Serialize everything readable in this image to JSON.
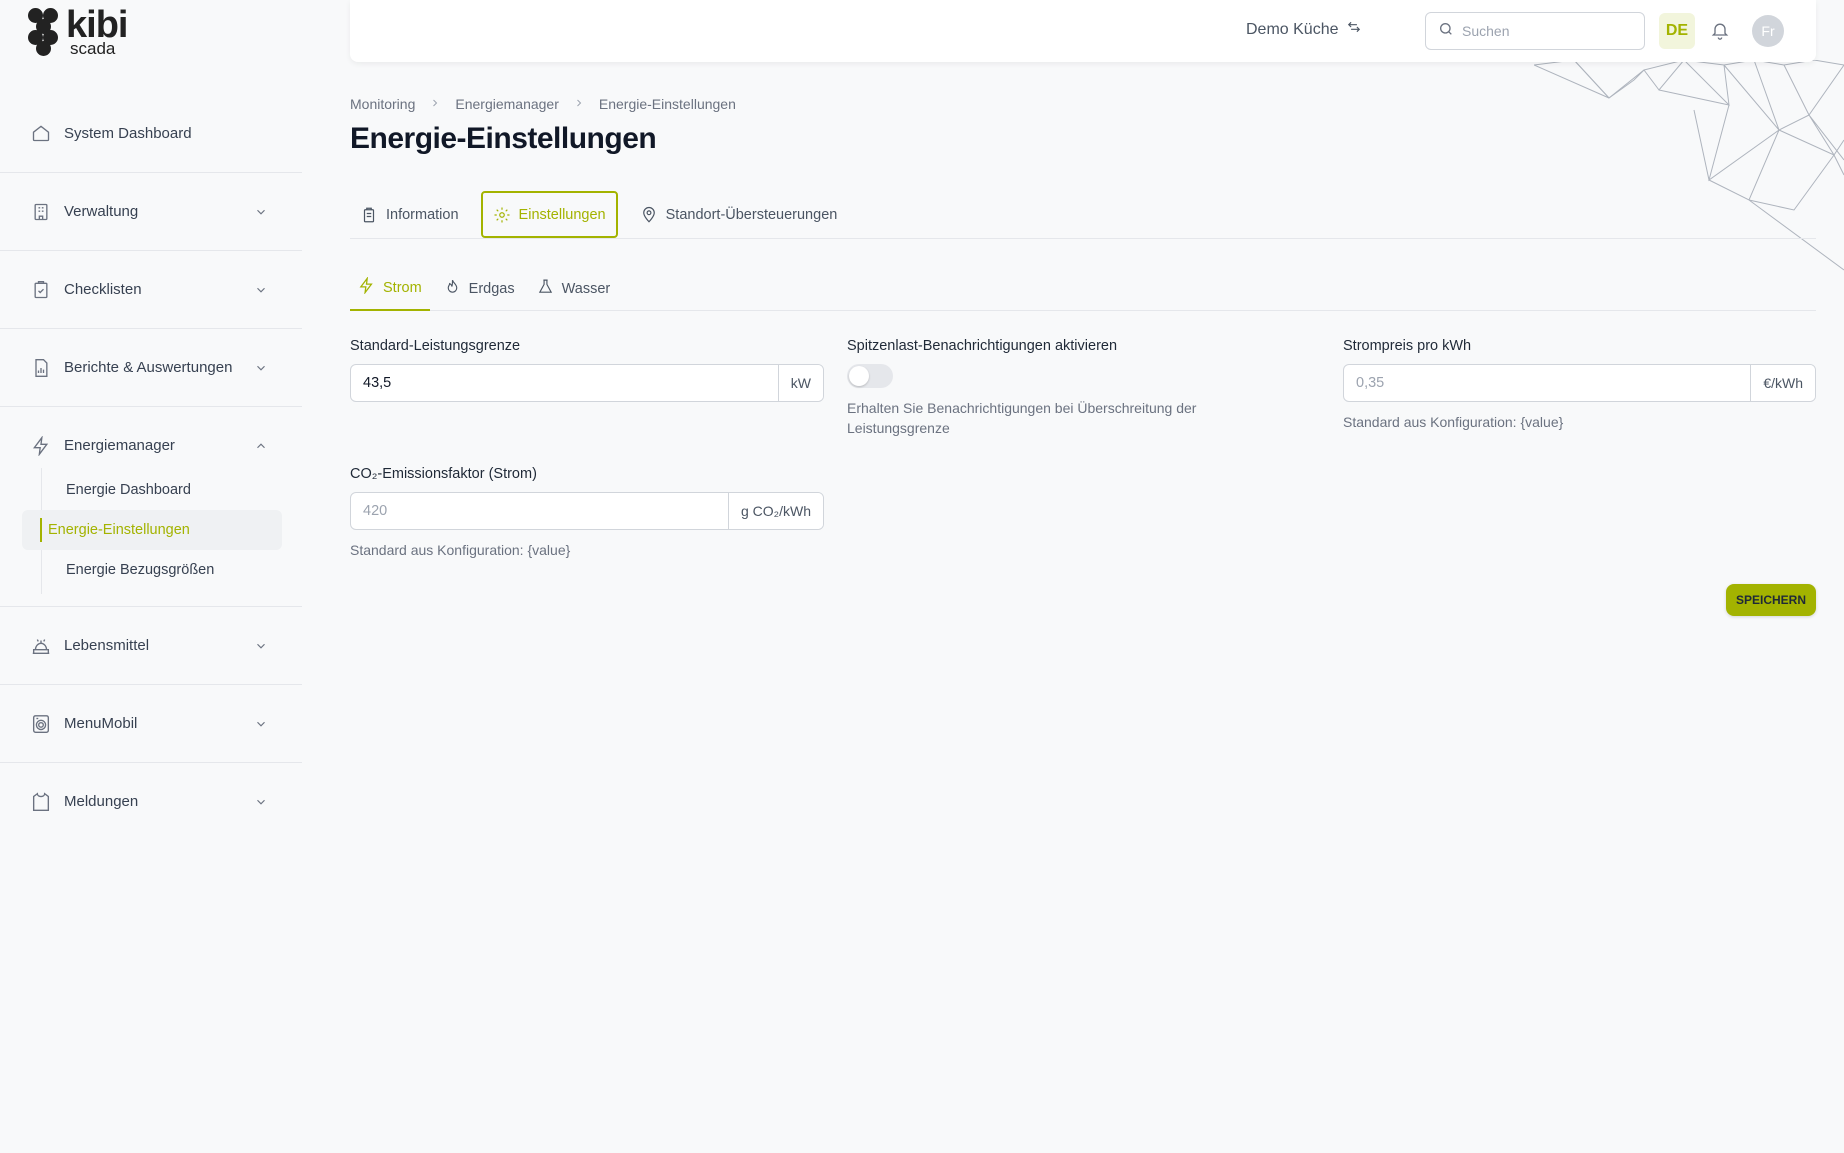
{
  "app": {
    "logo_name": "kibi",
    "logo_sub": "scada"
  },
  "sidebar": {
    "top_item": {
      "label": "System Dashboard",
      "icon": "home-icon"
    },
    "groups": [
      {
        "label": "Verwaltung",
        "icon": "building-icon",
        "expanded": false
      },
      {
        "label": "Checklisten",
        "icon": "clipboard-check-icon",
        "expanded": false
      },
      {
        "label": "Berichte & Auswertungen",
        "icon": "report-icon",
        "expanded": false
      },
      {
        "label": "Energiemanager",
        "icon": "lightning-icon",
        "expanded": true,
        "children": [
          {
            "label": "Energie Dashboard",
            "active": false
          },
          {
            "label": "Energie-Einstellungen",
            "active": true
          },
          {
            "label": "Energie Bezugsgrößen",
            "active": false
          }
        ]
      },
      {
        "label": "Lebensmittel",
        "icon": "food-icon",
        "expanded": false
      },
      {
        "label": "MenuMobil",
        "icon": "washer-icon",
        "expanded": false
      },
      {
        "label": "Meldungen",
        "icon": "shirt-icon",
        "expanded": false
      }
    ]
  },
  "header": {
    "kitchen": "Demo Küche",
    "search_placeholder": "Suchen",
    "language": "DE",
    "avatar_initials": "Fr"
  },
  "breadcrumb": [
    "Monitoring",
    "Energiemanager",
    "Energie-Einstellungen"
  ],
  "page_title": "Energie-Einstellungen",
  "tabs": [
    {
      "label": "Information",
      "icon": "clipboard-icon",
      "active": false
    },
    {
      "label": "Einstellungen",
      "icon": "gear-icon",
      "active": true
    },
    {
      "label": "Standort-Übersteuerungen",
      "icon": "location-pin-icon",
      "active": false
    }
  ],
  "subtabs": [
    {
      "label": "Strom",
      "icon": "lightning-icon",
      "active": true
    },
    {
      "label": "Erdgas",
      "icon": "flame-icon",
      "active": false
    },
    {
      "label": "Wasser",
      "icon": "flask-icon",
      "active": false
    }
  ],
  "form": {
    "power_limit": {
      "label": "Standard-Leistungsgrenze",
      "value": "43,5",
      "unit": "kW"
    },
    "peak_notify": {
      "label": "Spitzenlast-Benachrichtigungen aktivieren",
      "enabled": false,
      "hint": "Erhalten Sie Benachrichtigungen bei Überschreitung der Leistungsgrenze"
    },
    "price": {
      "label": "Strompreis pro kWh",
      "placeholder": "0,35",
      "unit": "€/kWh",
      "hint": "Standard aus Konfiguration: {value}"
    },
    "co2": {
      "label": "CO₂-Emissionsfaktor (Strom)",
      "placeholder": "420",
      "unit": "g CO₂/kWh",
      "hint": "Standard aus Konfiguration: {value}"
    }
  },
  "save_button": "SPEICHERN",
  "colors": {
    "accent": "#a3b300",
    "background": "#f8f9fa"
  }
}
